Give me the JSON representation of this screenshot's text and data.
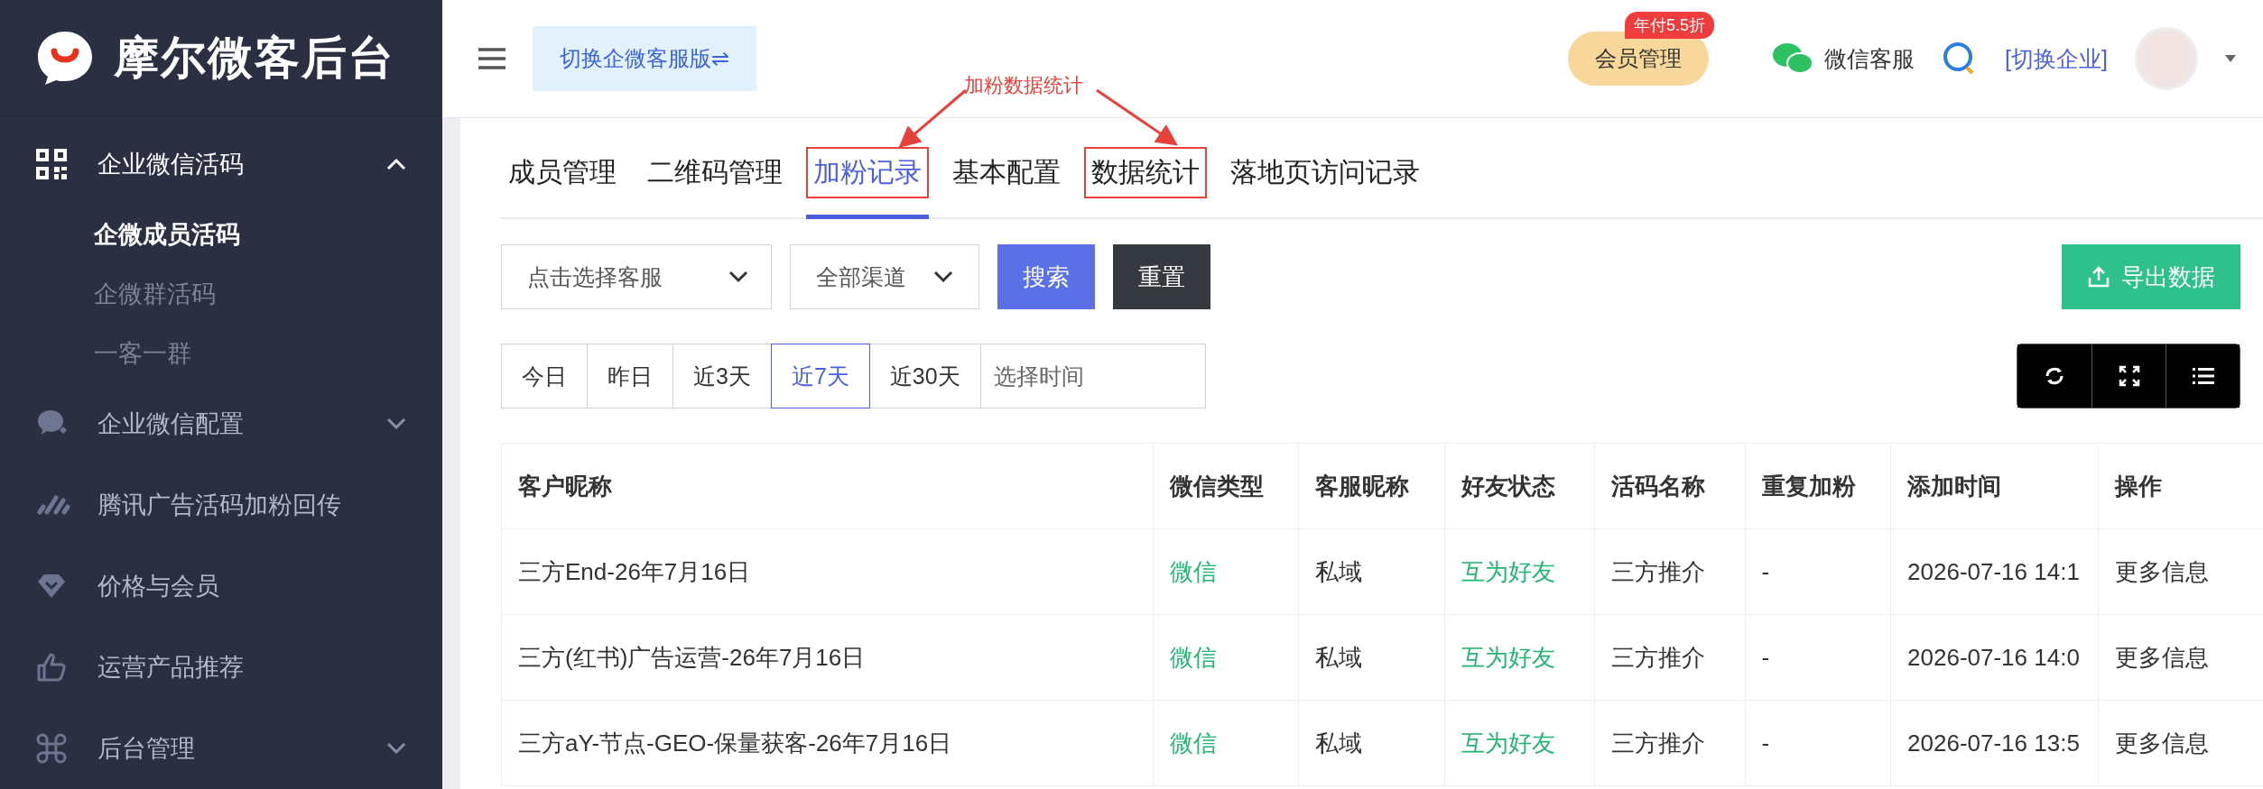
{
  "sidebar": {
    "logo_text": "摩尔微客后台",
    "menu": [
      {
        "label": "企业微信活码",
        "kind": "group",
        "expanded": true,
        "children": [
          {
            "label": "企微成员活码",
            "selected": true
          },
          {
            "label": "企微群活码",
            "selected": false
          },
          {
            "label": "一客一群",
            "selected": false
          }
        ]
      },
      {
        "label": "企业微信配置",
        "kind": "group",
        "expanded": false
      },
      {
        "label": "腾讯广告活码加粉回传",
        "kind": "link"
      },
      {
        "label": "价格与会员",
        "kind": "link"
      },
      {
        "label": "运营产品推荐",
        "kind": "link"
      },
      {
        "label": "后台管理",
        "kind": "group",
        "expanded": false
      }
    ]
  },
  "header": {
    "switch_button": "切换企微客服版⇌",
    "member_button": "会员管理",
    "member_badge": "年付5.5折",
    "service_link": "微信客服",
    "company_switch": "[切换企业]"
  },
  "annotation": {
    "label": "加粉数据统计"
  },
  "tabs": [
    {
      "label": "成员管理",
      "selected": false,
      "highlighted": false
    },
    {
      "label": "二维码管理",
      "selected": false,
      "highlighted": false
    },
    {
      "label": "加粉记录",
      "selected": true,
      "highlighted": true
    },
    {
      "label": "基本配置",
      "selected": false,
      "highlighted": false
    },
    {
      "label": "数据统计",
      "selected": false,
      "highlighted": true
    },
    {
      "label": "落地页访问记录",
      "selected": false,
      "highlighted": false
    }
  ],
  "filters": {
    "agent_select": {
      "placeholder": "点击选择客服"
    },
    "channel_select": "全部渠道",
    "search_button": "搜索",
    "reset_button": "重置",
    "export_button": "导出数据"
  },
  "date_ranges": [
    {
      "label": "今日",
      "selected": false
    },
    {
      "label": "昨日",
      "selected": false
    },
    {
      "label": "近3天",
      "selected": false
    },
    {
      "label": "近7天",
      "selected": true
    },
    {
      "label": "近30天",
      "selected": false
    }
  ],
  "date_picker": {
    "placeholder": "选择时间"
  },
  "table": {
    "columns": [
      "客户昵称",
      "微信类型",
      "客服昵称",
      "好友状态",
      "活码名称",
      "重复加粉",
      "添加时间",
      "操作"
    ],
    "rows": [
      [
        "三方End-26年7月16日",
        "微信",
        "私域",
        "互为好友",
        "三方推介",
        "-",
        "2026-07-16 14:1",
        "更多信息"
      ],
      [
        "三方(红书)广告运营-26年7月16日",
        "微信",
        "私域",
        "互为好友",
        "三方推介",
        "-",
        "2026-07-16 14:0",
        "更多信息"
      ],
      [
        "三方aY-节点-GEO-保量获客-26年7月16日",
        "微信",
        "私域",
        "互为好友",
        "三方推介",
        "-",
        "2026-07-16 13:5",
        "更多信息"
      ]
    ]
  }
}
